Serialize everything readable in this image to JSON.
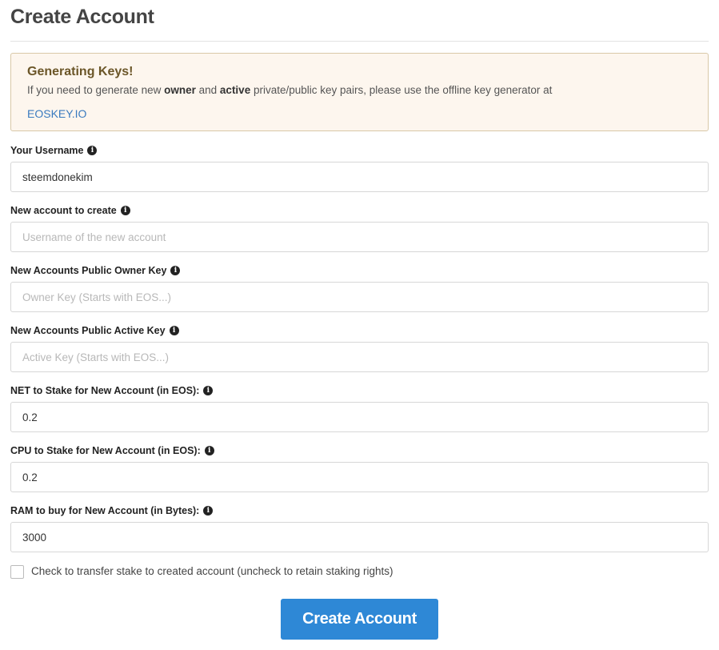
{
  "page": {
    "title": "Create Account"
  },
  "alert": {
    "heading": "Generating Keys!",
    "text_before": "If you need to generate new ",
    "owner_word": "owner",
    "text_and": " and ",
    "active_word": "active",
    "text_after": " private/public key pairs, please use the offline key generator at",
    "link_text": "EOSKEY.IO"
  },
  "form": {
    "username": {
      "label": "Your Username",
      "value": "steemdonekim",
      "placeholder": ""
    },
    "new_account": {
      "label": "New account to create",
      "value": "",
      "placeholder": "Username of the new account"
    },
    "owner_key": {
      "label": "New Accounts Public Owner Key",
      "value": "",
      "placeholder": "Owner Key (Starts with EOS...)"
    },
    "active_key": {
      "label": "New Accounts Public Active Key",
      "value": "",
      "placeholder": "Active Key (Starts with EOS...)"
    },
    "net_stake": {
      "label": "NET to Stake for New Account (in EOS):",
      "value": "0.2",
      "placeholder": ""
    },
    "cpu_stake": {
      "label": "CPU to Stake for New Account (in EOS):",
      "value": "0.2",
      "placeholder": ""
    },
    "ram_bytes": {
      "label": "RAM to buy for New Account (in Bytes):",
      "value": "3000",
      "placeholder": ""
    },
    "transfer_checkbox_label": "Check to transfer stake to created account (uncheck to retain staking rights)",
    "transfer_checked": false,
    "submit_label": "Create Account"
  },
  "icons": {
    "info": "info-circle-icon"
  },
  "colors": {
    "primary_button": "#2e88d6",
    "alert_background": "#fdf6ee",
    "alert_heading": "#6b5628",
    "link": "#3a7bbf"
  }
}
